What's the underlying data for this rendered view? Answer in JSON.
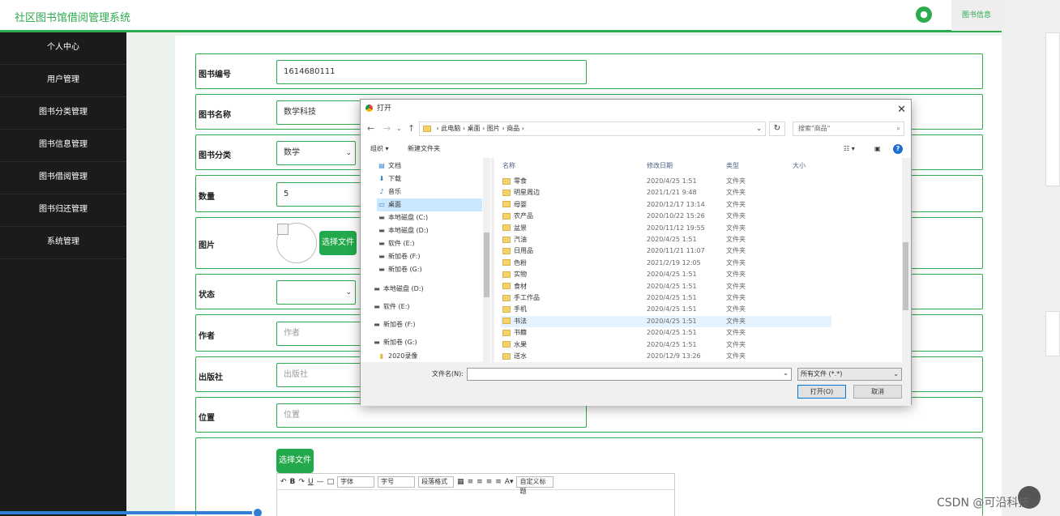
{
  "app": {
    "title": "社区图书馆借阅管理系统",
    "top_tab": "图书信息"
  },
  "sidebar": {
    "items": [
      "个人中心",
      "用户管理",
      "图书分类管理",
      "图书信息管理",
      "图书借阅管理",
      "图书归还管理",
      "系统管理"
    ]
  },
  "form": {
    "book_no": {
      "label": "图书编号",
      "value": "1614680111"
    },
    "book_name": {
      "label": "图书名称",
      "value": "数学科技"
    },
    "category": {
      "label": "图书分类",
      "value": "数学"
    },
    "quantity": {
      "label": "数量",
      "value": "5"
    },
    "image": {
      "label": "图片",
      "button": "选择文件"
    },
    "status": {
      "label": "状态",
      "value": ""
    },
    "author": {
      "label": "作者",
      "placeholder": "作者"
    },
    "publisher": {
      "label": "出版社",
      "placeholder": "出版社"
    },
    "location": {
      "label": "位置",
      "placeholder": "位置"
    },
    "detail": {
      "button": "选择文件"
    },
    "editor_toolbar": {
      "font": "字体",
      "size": "字号",
      "para": "段落格式",
      "custom": "自定义标题"
    }
  },
  "dialog": {
    "title": "打开",
    "path": [
      "此电脑",
      "桌面",
      "图片",
      "商品"
    ],
    "search_placeholder": "搜索\"商品\"",
    "toolbar": {
      "organize": "组织 ▾",
      "new_folder": "新建文件夹"
    },
    "nav_items": [
      {
        "icon": "doc",
        "label": "文档"
      },
      {
        "icon": "down",
        "label": "下载"
      },
      {
        "icon": "music",
        "label": "音乐"
      },
      {
        "icon": "desktop",
        "label": "桌面"
      },
      {
        "icon": "drive",
        "label": "本地磁盘 (C:)"
      },
      {
        "icon": "drive",
        "label": "本地磁盘 (D:)"
      },
      {
        "icon": "drive",
        "label": "软件 (E:)"
      },
      {
        "icon": "drive",
        "label": "新加卷 (F:)"
      },
      {
        "icon": "drive",
        "label": "新加卷 (G:)"
      },
      {
        "icon": "drive",
        "label": "本地磁盘 (D:)"
      },
      {
        "icon": "drive",
        "label": "软件 (E:)"
      },
      {
        "icon": "drive",
        "label": "新加卷 (F:)"
      },
      {
        "icon": "drive",
        "label": "新加卷 (G:)"
      },
      {
        "icon": "folder",
        "label": "2020录像"
      }
    ],
    "columns": {
      "name": "名称",
      "date": "修改日期",
      "type": "类型",
      "size": "大小"
    },
    "files": [
      {
        "name": "零食",
        "date": "2020/4/25 1:51",
        "type": "文件夹"
      },
      {
        "name": "明星周边",
        "date": "2021/1/21 9:48",
        "type": "文件夹"
      },
      {
        "name": "母婴",
        "date": "2020/12/17 13:14",
        "type": "文件夹"
      },
      {
        "name": "农产品",
        "date": "2020/10/22 15:26",
        "type": "文件夹"
      },
      {
        "name": "盆景",
        "date": "2020/11/12 19:55",
        "type": "文件夹"
      },
      {
        "name": "汽油",
        "date": "2020/4/25 1:51",
        "type": "文件夹"
      },
      {
        "name": "日用品",
        "date": "2020/11/21 11:07",
        "type": "文件夹"
      },
      {
        "name": "色粉",
        "date": "2021/2/19 12:05",
        "type": "文件夹"
      },
      {
        "name": "实物",
        "date": "2020/4/25 1:51",
        "type": "文件夹"
      },
      {
        "name": "食材",
        "date": "2020/4/25 1:51",
        "type": "文件夹"
      },
      {
        "name": "手工作品",
        "date": "2020/4/25 1:51",
        "type": "文件夹"
      },
      {
        "name": "手机",
        "date": "2020/4/25 1:51",
        "type": "文件夹"
      },
      {
        "name": "书法",
        "date": "2020/4/25 1:51",
        "type": "文件夹"
      },
      {
        "name": "书籍",
        "date": "2020/4/25 1:51",
        "type": "文件夹"
      },
      {
        "name": "水果",
        "date": "2020/4/25 1:51",
        "type": "文件夹"
      },
      {
        "name": "送水",
        "date": "2020/12/9 13:26",
        "type": "文件夹"
      }
    ],
    "filename_label": "文件名(N):",
    "filetype": "所有文件 (*.*)",
    "open_button": "打开(O)",
    "cancel_button": "取消"
  },
  "watermark": "CSDN @可沿科技"
}
